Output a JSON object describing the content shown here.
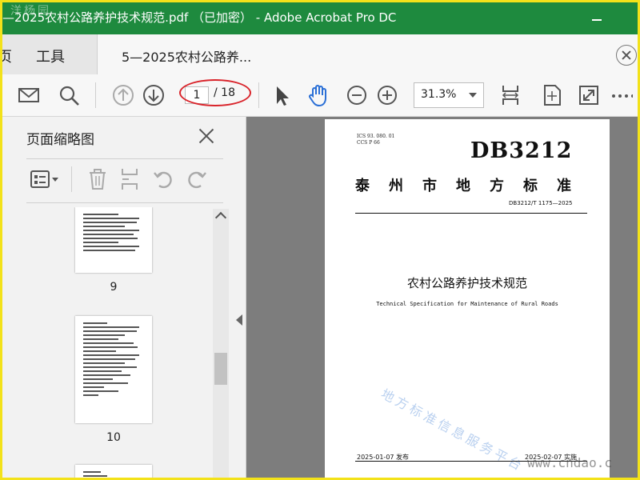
{
  "window": {
    "title": "—2025农村公路养护技术规范.pdf （已加密） - Adobe Acrobat Pro DC",
    "watermark_top": "洋杨园"
  },
  "tabs": {
    "home": "页",
    "tools": "工具",
    "document": "5—2025农村公路养..."
  },
  "toolbar": {
    "current_page": "1",
    "total_pages": "/ 18",
    "zoom": "31.3%"
  },
  "panel": {
    "title": "页面缩略图",
    "thumbnails": [
      {
        "label": "9"
      },
      {
        "label": "10"
      }
    ]
  },
  "document": {
    "ics": "ICS 93. 080. 01",
    "ccs": "CCS P 66",
    "code": "DB3212",
    "standard_type": "泰州市地方标准",
    "standard_number": "DB3212/T 1175—2025",
    "title_cn": "农村公路养护技术规范",
    "title_en": "Technical Specification for Maintenance of Rural Roads",
    "publish_date": "2025-01-07 发布",
    "implement_date": "2025-02-07 实施",
    "watermark": "地方标准信息服务平台"
  },
  "site_watermark": "www.cndao.c",
  "colors": {
    "titlebar": "#1e8a3e",
    "highlight_oval": "#d9242b",
    "hand_tool": "#2a6fd6"
  }
}
